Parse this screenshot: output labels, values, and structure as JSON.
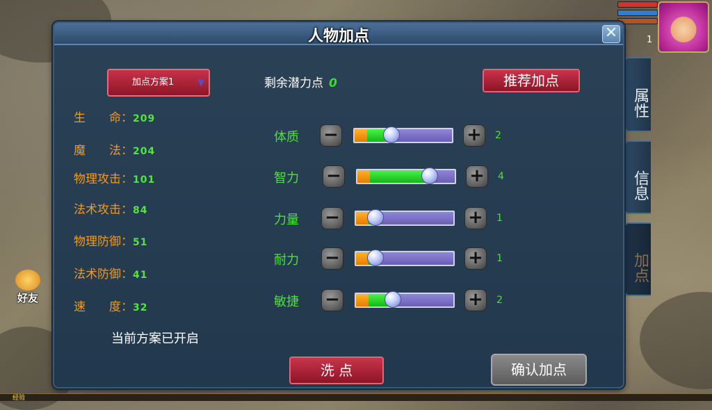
{
  "panel": {
    "title": "人物加点",
    "close_icon": "close-icon"
  },
  "plan": {
    "selected": "加点方案1",
    "status_text": "当前方案已开启"
  },
  "stats": [
    {
      "label": "生　　命：",
      "value": "209"
    },
    {
      "label": "魔　　法：",
      "value": "204"
    },
    {
      "label": "物理攻击：",
      "value": "101"
    },
    {
      "label": "法术攻击：",
      "value": "84"
    },
    {
      "label": "物理防御：",
      "value": "51"
    },
    {
      "label": "法术防御：",
      "value": "41"
    },
    {
      "label": "速　　度：",
      "value": "32"
    }
  ],
  "points": {
    "remaining_label": "剩余潜力点",
    "remaining_value": "0",
    "recommend_label": "推荐加点"
  },
  "attributes": [
    {
      "label": "体质",
      "value": "2",
      "fill_fraction": 0.31
    },
    {
      "label": "智力",
      "value": "4",
      "fill_fraction": 0.67
    },
    {
      "label": "力量",
      "value": "1",
      "fill_fraction": 0.13
    },
    {
      "label": "耐力",
      "value": "1",
      "fill_fraction": 0.13
    },
    {
      "label": "敏捷",
      "value": "2",
      "fill_fraction": 0.31
    }
  ],
  "buttons": {
    "wash": "洗 点",
    "confirm": "确认加点"
  },
  "side_tabs": [
    {
      "label": "属性",
      "active": false
    },
    {
      "label": "信息",
      "active": false
    },
    {
      "label": "加点",
      "active": true
    }
  ],
  "hud": {
    "level": "1",
    "friend_label": "好友",
    "exp_label": "经验"
  },
  "colors": {
    "stat_label": "#f39a1a",
    "stat_value": "#53e442",
    "attr_label": "#4ee03b",
    "button_red": "#c9334b"
  }
}
